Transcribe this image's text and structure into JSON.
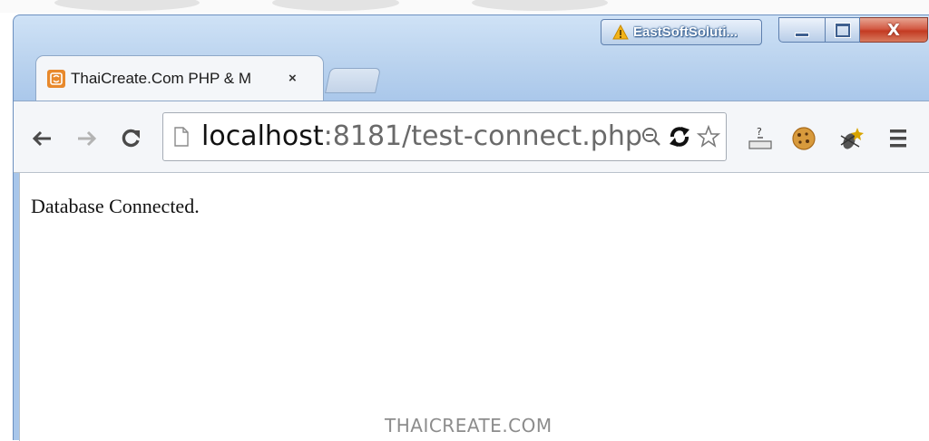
{
  "browser": {
    "profile_label": "EastSoftSoluti...",
    "tab": {
      "title": "ThaiCreate.Com PHP & M",
      "close_glyph": "×"
    },
    "address_bar": {
      "host": "localhost",
      "rest": ":8181/test-connect.php"
    },
    "window_controls": {
      "close_glyph": "X"
    }
  },
  "page": {
    "body_text": "Database Connected."
  },
  "watermark": {
    "text": "THAICREATE.COM"
  },
  "icons": {
    "back": "back-arrow-icon",
    "forward": "forward-arrow-icon",
    "reload": "reload-icon",
    "page": "page-icon",
    "zoom": "zoom-icon",
    "sync": "sync-icon",
    "star": "bookmark-star-icon",
    "ext1": "download-tray-icon",
    "ext2": "cookie-icon",
    "ext3": "bug-icon",
    "menu": "menu-icon"
  },
  "colors": {
    "favicon": "#e8892c",
    "close_button": "#c33a22",
    "frame": "#b9d2ee"
  }
}
